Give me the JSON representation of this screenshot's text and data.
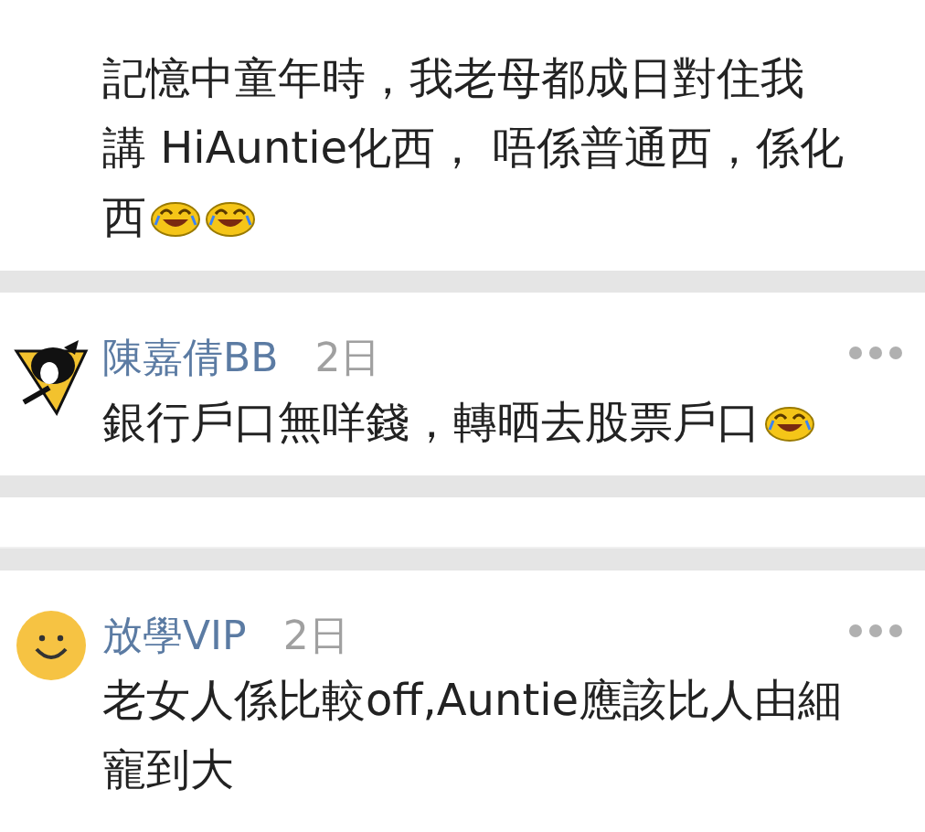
{
  "comments": [
    {
      "kind": "plain",
      "lines": [
        [
          {
            "kind": "text",
            "text": "記憶中童年時，我老母都成日對住我"
          }
        ],
        [
          {
            "kind": "text",
            "text": "講 HiAuntie化西， 唔係普通西，係化"
          }
        ],
        [
          {
            "kind": "text",
            "text": "西"
          },
          {
            "kind": "emoji"
          },
          {
            "kind": "emoji"
          }
        ]
      ]
    },
    {
      "header": {
        "name": "陳嘉倩BB",
        "time": "2日"
      },
      "kind": "penguin",
      "lines": [
        [
          {
            "kind": "text",
            "text": "銀行戶口無咩錢，轉晒去股票戶口"
          },
          {
            "kind": "emoji"
          }
        ]
      ]
    },
    {
      "header": {
        "name": "放學VIP",
        "time": "2日"
      },
      "kind": "smiley",
      "lines": [
        [
          {
            "kind": "text",
            "text": "老女人係比較off,Auntie應該比人由細"
          }
        ],
        [
          {
            "kind": "text",
            "text": "寵到大"
          }
        ]
      ]
    }
  ]
}
